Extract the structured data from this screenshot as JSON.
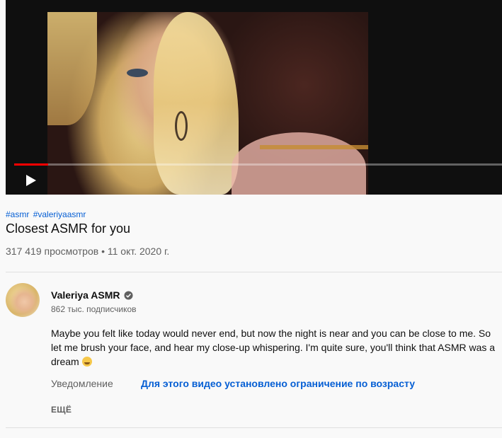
{
  "player": {
    "progress_fraction": 0.07,
    "play_icon": "play-icon",
    "accent_color": "#ff0000"
  },
  "video": {
    "hashtags": [
      "#asmr",
      "#valeriyaasmr"
    ],
    "title": "Closest ASMR for you",
    "views_date": "317 419 просмотров • 11 окт. 2020 г."
  },
  "channel": {
    "name": "Valeriya ASMR",
    "verified_icon": "verified-check-icon",
    "subscribers": "862 тыс. подписчиков"
  },
  "description": {
    "text": "Maybe you felt like today would never end, but now the night is near and you can be close to me. So let me brush your face, and hear my close-up whispering. I'm quite sure, you'll think that ASMR was a dream",
    "emoji": "sleeping-face-emoji"
  },
  "notice": {
    "label": "Уведомление",
    "link": "Для этого видео установлено ограничение по возрасту"
  },
  "more_label": "ЕЩЁ",
  "colors": {
    "link": "#065fd4",
    "secondary_text": "#606060"
  }
}
